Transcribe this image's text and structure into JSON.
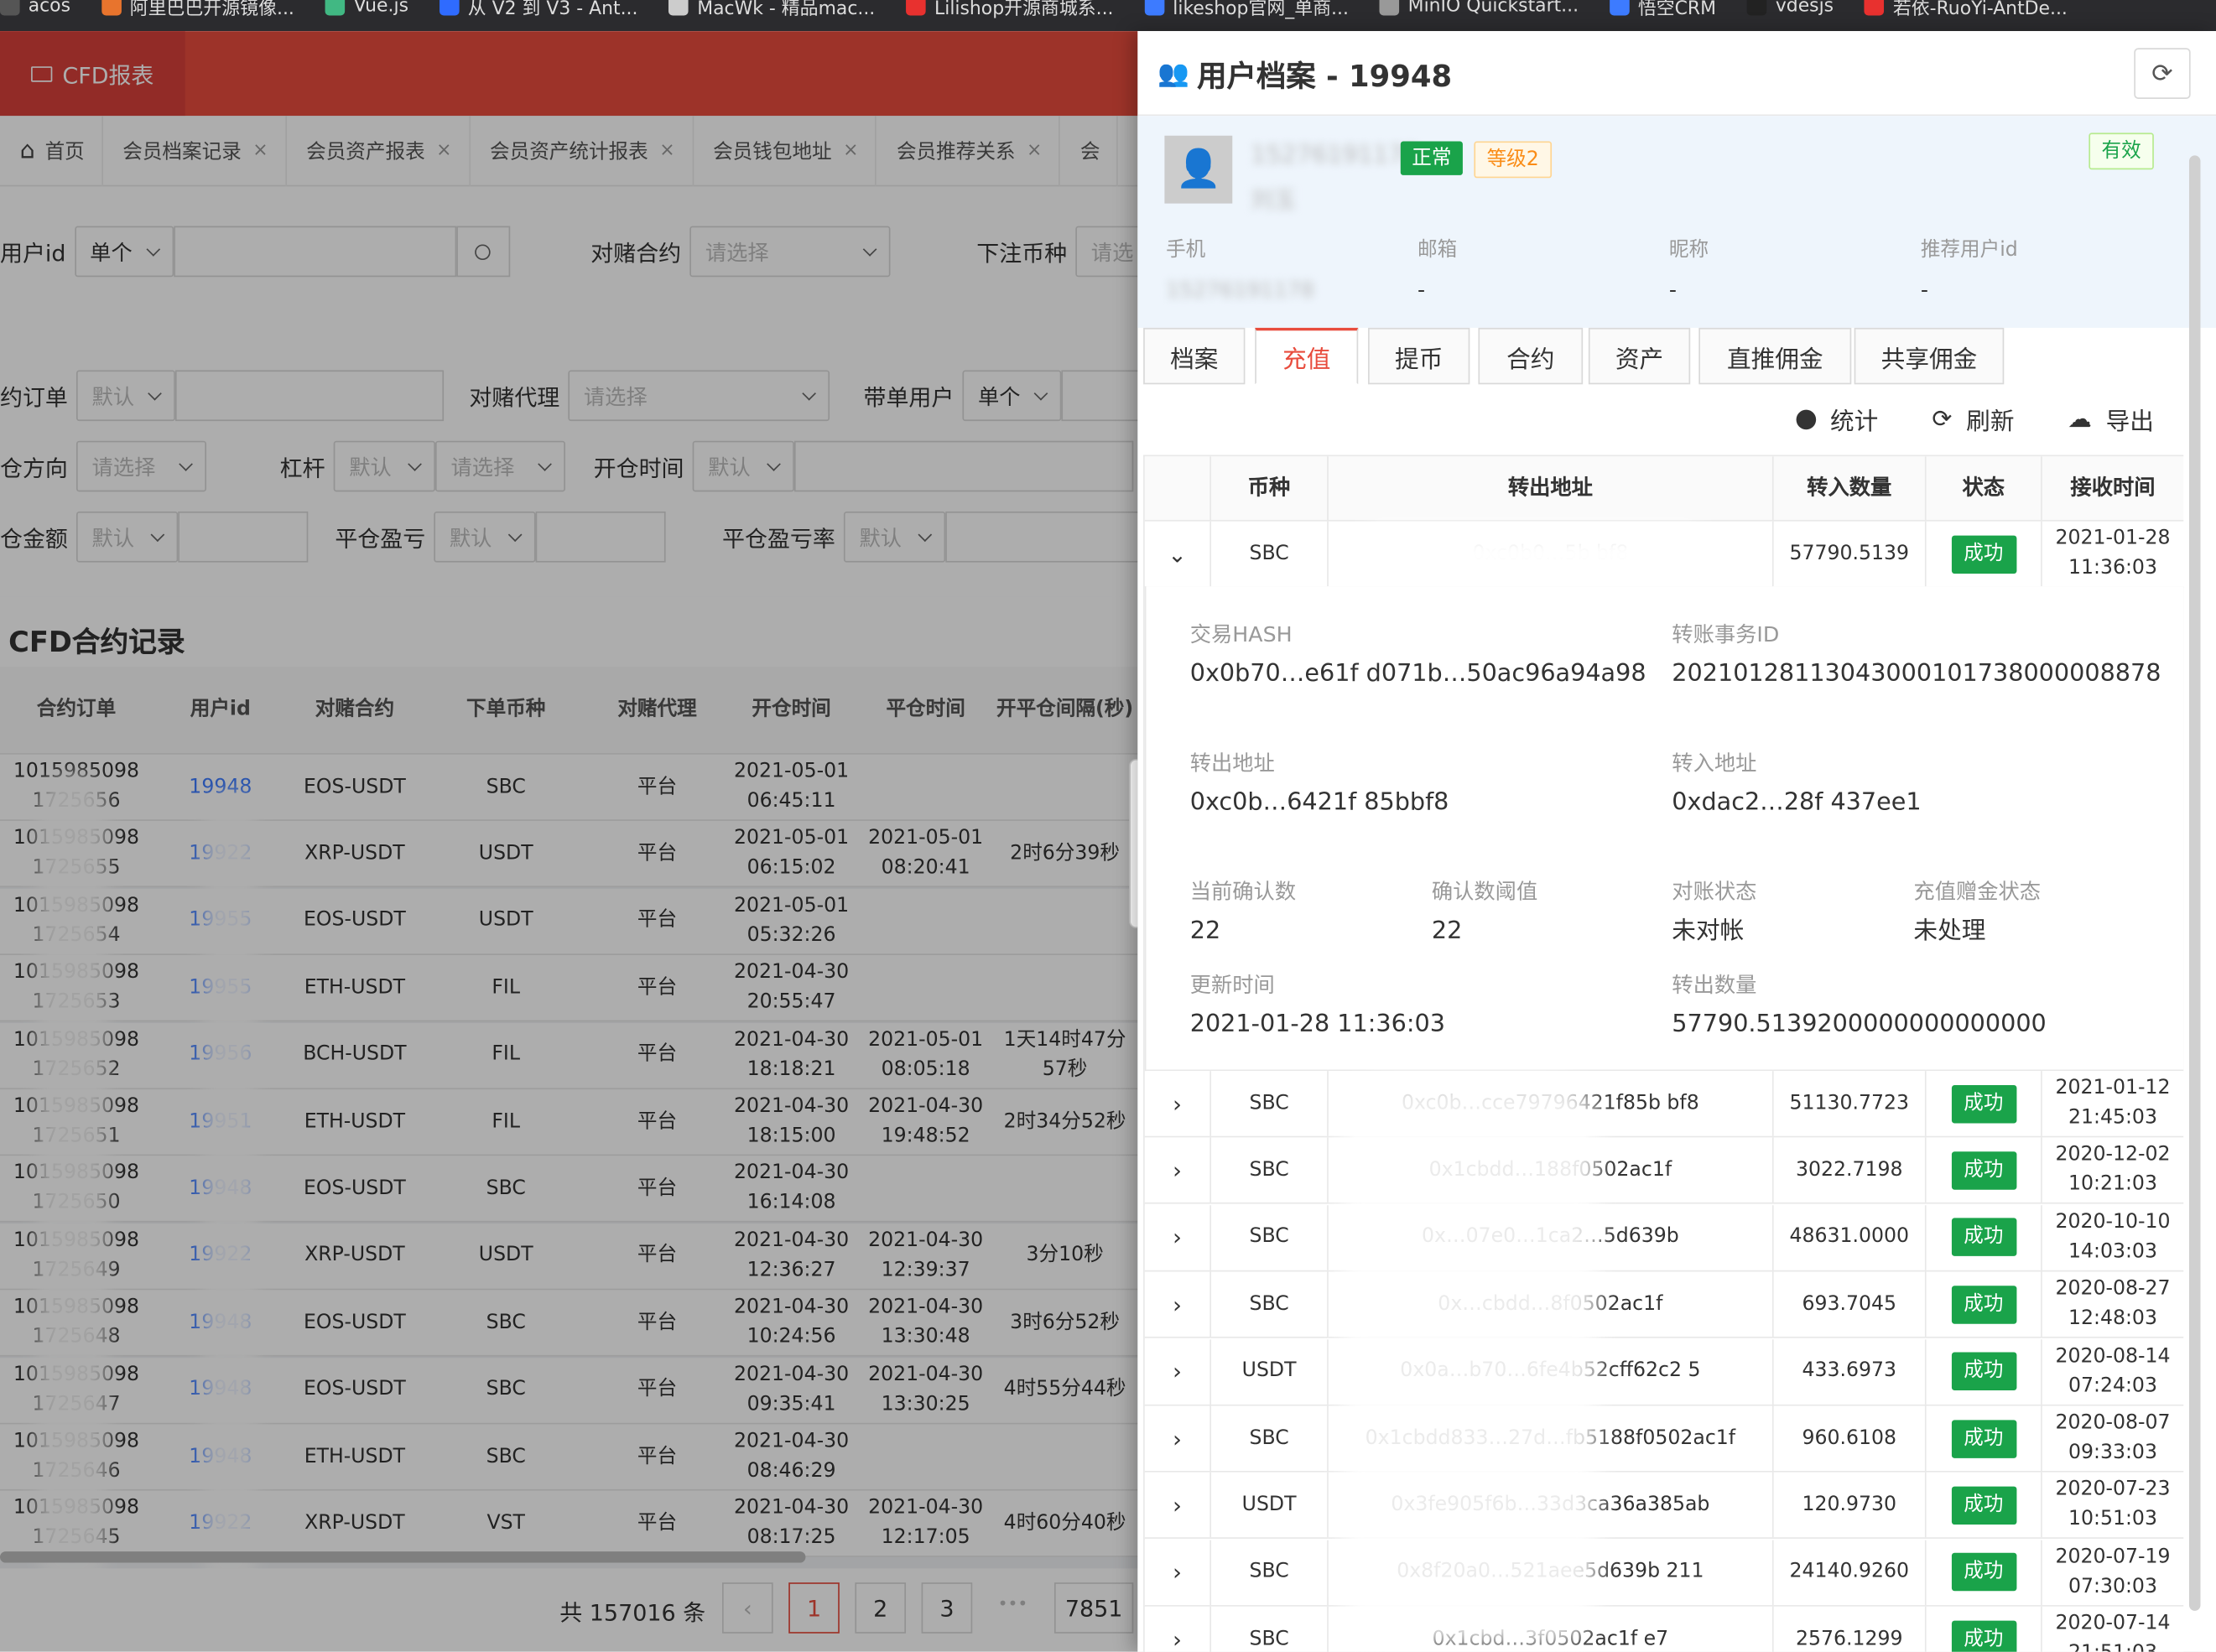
{
  "bookmarks": [
    {
      "label": "acos",
      "color": "#555"
    },
    {
      "label": "阿里巴巴开源镜像...",
      "color": "#e8742d"
    },
    {
      "label": "Vue.js",
      "color": "#41b883"
    },
    {
      "label": "从 V2 到 V3 - Ant...",
      "color": "#2f6bff"
    },
    {
      "label": "MacWk - 精品mac...",
      "color": "#ccc"
    },
    {
      "label": "Lilishop开源商城系...",
      "color": "#e8312f"
    },
    {
      "label": "likeshop官网_单商...",
      "color": "#3d7bff"
    },
    {
      "label": "MinIO Quickstart...",
      "color": "#999"
    },
    {
      "label": "悟空CRM",
      "color": "#3d7bff"
    },
    {
      "label": "vdesjs",
      "color": "#222"
    },
    {
      "label": "若依-RuoYi-AntDe...",
      "color": "#e8312f"
    }
  ],
  "app": {
    "logo": "CFD报表",
    "home": "首页"
  },
  "left_tabs": [
    "会员档案记录",
    "会员资产报表",
    "会员资产统计报表",
    "会员钱包地址",
    "会员推荐关系",
    "会"
  ],
  "filters": {
    "user_id": "用户id",
    "single": "单个",
    "contract": "对赌合约",
    "please_select": "请选择",
    "order_coin": "下注币种",
    "select_short": "请选",
    "order_no": "约订单",
    "default": "默认",
    "agent": "对赌代理",
    "lead_user": "带单用户",
    "direction": "仓方向",
    "leverage": "杠杆",
    "open_time": "开仓时间",
    "amount": "仓金额",
    "pnl": "平仓盈亏",
    "pnl_rate": "平仓盈亏率"
  },
  "left_section_title": "CFD合约记录",
  "left_table": {
    "headers": [
      "合约订单",
      "用户id",
      "对赌合约",
      "下单币种",
      "对赌代理",
      "开仓时间",
      "平仓时间",
      "开平仓间隔(秒)"
    ],
    "rows": [
      {
        "order": "1015985098 1725656",
        "uid": "19948",
        "contract": "EOS-USDT",
        "coin": "SBC",
        "agent": "平台",
        "open": "2021-05-01 06:45:11",
        "close": "",
        "gap": ""
      },
      {
        "order": "1015985098 1725655",
        "uid": "19922",
        "contract": "XRP-USDT",
        "coin": "USDT",
        "agent": "平台",
        "open": "2021-05-01 06:15:02",
        "close": "2021-05-01 08:20:41",
        "gap": "2时6分39秒"
      },
      {
        "order": "1015985098 1725654",
        "uid": "19955",
        "contract": "EOS-USDT",
        "coin": "USDT",
        "agent": "平台",
        "open": "2021-05-01 05:32:26",
        "close": "",
        "gap": ""
      },
      {
        "order": "1015985098 1725653",
        "uid": "19955",
        "contract": "ETH-USDT",
        "coin": "FIL",
        "agent": "平台",
        "open": "2021-04-30 20:55:47",
        "close": "",
        "gap": ""
      },
      {
        "order": "1015985098 1725652",
        "uid": "19956",
        "contract": "BCH-USDT",
        "coin": "FIL",
        "agent": "平台",
        "open": "2021-04-30 18:18:21",
        "close": "2021-05-01 08:05:18",
        "gap": "1天14时47分57秒"
      },
      {
        "order": "1015985098 1725651",
        "uid": "19951",
        "contract": "ETH-USDT",
        "coin": "FIL",
        "agent": "平台",
        "open": "2021-04-30 18:15:00",
        "close": "2021-04-30 19:48:52",
        "gap": "2时34分52秒"
      },
      {
        "order": "1015985098 1725650",
        "uid": "19948",
        "contract": "EOS-USDT",
        "coin": "SBC",
        "agent": "平台",
        "open": "2021-04-30 16:14:08",
        "close": "",
        "gap": ""
      },
      {
        "order": "1015985098 1725649",
        "uid": "19922",
        "contract": "XRP-USDT",
        "coin": "USDT",
        "agent": "平台",
        "open": "2021-04-30 12:36:27",
        "close": "2021-04-30 12:39:37",
        "gap": "3分10秒"
      },
      {
        "order": "1015985098 1725648",
        "uid": "19948",
        "contract": "EOS-USDT",
        "coin": "SBC",
        "agent": "平台",
        "open": "2021-04-30 10:24:56",
        "close": "2021-04-30 13:30:48",
        "gap": "3时6分52秒"
      },
      {
        "order": "1015985098 1725647",
        "uid": "19948",
        "contract": "EOS-USDT",
        "coin": "SBC",
        "agent": "平台",
        "open": "2021-04-30 09:35:41",
        "close": "2021-04-30 13:30:25",
        "gap": "4时55分44秒"
      },
      {
        "order": "1015985098 1725646",
        "uid": "19948",
        "contract": "ETH-USDT",
        "coin": "SBC",
        "agent": "平台",
        "open": "2021-04-30 08:46:29",
        "close": "",
        "gap": ""
      },
      {
        "order": "1015985098 1725645",
        "uid": "19922",
        "contract": "XRP-USDT",
        "coin": "VST",
        "agent": "平台",
        "open": "2021-04-30 08:17:25",
        "close": "2021-04-30 12:17:05",
        "gap": "4时60分40秒"
      }
    ]
  },
  "pagination": {
    "total": "共 157016 条",
    "pages": [
      "1",
      "2",
      "3"
    ],
    "ellipsis": "•••",
    "last": "7851",
    "prev": "‹"
  },
  "drawer": {
    "title": "用户档案 - 19948",
    "phone_masked": "15276191178",
    "name_masked": "刘玉",
    "status_tag": "正常",
    "level_tag": "等级2",
    "valid_tag": "有效",
    "fields": [
      {
        "label": "手机",
        "value": "15276191178"
      },
      {
        "label": "邮箱",
        "value": "-"
      },
      {
        "label": "昵称",
        "value": "-"
      },
      {
        "label": "推荐用户id",
        "value": "-"
      }
    ],
    "tabs": [
      "档案",
      "充值",
      "提币",
      "合约",
      "资产",
      "直推佣金",
      "共享佣金"
    ],
    "active_tab": "充值",
    "toolbar": {
      "stats": "统计",
      "refresh": "刷新",
      "export": "导出"
    },
    "table_headers": [
      "币种",
      "转出地址",
      "转入数量",
      "状态",
      "接收时间"
    ],
    "expanded": {
      "coin": "SBC",
      "addr": "0xc0b0…5b bf8",
      "amount": "57790.5139",
      "status": "成功",
      "time": "2021-01-28 11:36:03",
      "hash_label": "交易HASH",
      "hash": "0x0b70…e61f d071b…50ac96a94a98",
      "tx_label": "转账事务ID",
      "tx": "20210128113043000101738000008878",
      "from_label": "转出地址",
      "from": "0xc0b…6421f 85bbf8",
      "to_label": "转入地址",
      "to": "0xdac2…28f 437ee1",
      "confirm_label": "当前确认数",
      "confirm": "22",
      "threshold_label": "确认数阈值",
      "threshold": "22",
      "recon_label": "对账状态",
      "recon": "未对帐",
      "bonus_label": "充值赠金状态",
      "bonus": "未处理",
      "update_label": "更新时间",
      "update": "2021-01-28 11:36:03",
      "out_label": "转出数量",
      "out": "57790.5139200000000000000"
    },
    "rows": [
      {
        "coin": "SBC",
        "addr": "0xc0b…cce79796421f85b bf8",
        "amount": "51130.7723",
        "status": "成功",
        "time": "2021-01-12 21:45:03"
      },
      {
        "coin": "SBC",
        "addr": "0x1cbdd…188f0502ac1f",
        "amount": "3022.7198",
        "status": "成功",
        "time": "2020-12-02 10:21:03"
      },
      {
        "coin": "SBC",
        "addr": "0x…07e0…1ca2…5d639b",
        "amount": "48631.0000",
        "status": "成功",
        "time": "2020-10-10 14:03:03"
      },
      {
        "coin": "SBC",
        "addr": "0x…cbdd…8f0502ac1f",
        "amount": "693.7045",
        "status": "成功",
        "time": "2020-08-27 12:48:03"
      },
      {
        "coin": "USDT",
        "addr": "0x0a…b70…6fe4b52cff62c2 5",
        "amount": "433.6973",
        "status": "成功",
        "time": "2020-08-14 07:24:03"
      },
      {
        "coin": "SBC",
        "addr": "0x1cbdd833…27d…fb5188f0502ac1f",
        "amount": "960.6108",
        "status": "成功",
        "time": "2020-08-07 09:33:03"
      },
      {
        "coin": "USDT",
        "addr": "0x3fe905f6b…33d3ca36a385ab",
        "amount": "120.9730",
        "status": "成功",
        "time": "2020-07-23 10:51:03"
      },
      {
        "coin": "SBC",
        "addr": "0x8f20a0…521aee5d639b 211",
        "amount": "24140.9260",
        "status": "成功",
        "time": "2020-07-19 07:30:03"
      },
      {
        "coin": "SBC",
        "addr": "0x1cbd…3f0502ac1f e7",
        "amount": "2576.1299",
        "status": "成功",
        "time": "2020-07-14 21:51:03"
      }
    ]
  },
  "colors": {
    "brand": "#e84c3d",
    "success": "#1aa34a",
    "level": "#fa8c16"
  }
}
